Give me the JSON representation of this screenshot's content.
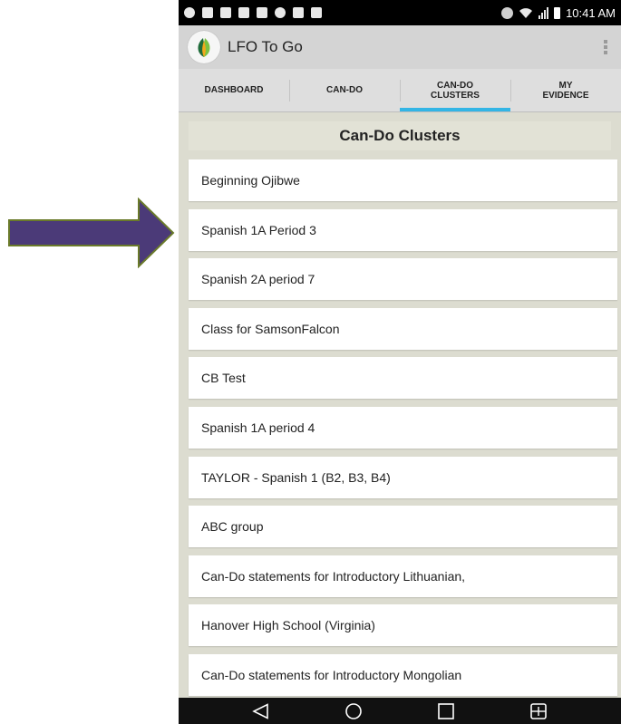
{
  "status_bar": {
    "time": "10:41 AM"
  },
  "action_bar": {
    "app_title": "LFO To Go",
    "app_icon": "leaf-logo-icon",
    "overflow_icon": "overflow-menu-icon"
  },
  "tabs": [
    {
      "label": "DASHBOARD",
      "selected": false
    },
    {
      "label": "CAN-DO",
      "selected": false
    },
    {
      "label": "CAN-DO\nCLUSTERS",
      "selected": true
    },
    {
      "label": "MY\nEVIDENCE",
      "selected": false
    }
  ],
  "content": {
    "section_title": "Can-Do Clusters",
    "clusters": [
      "Beginning Ojibwe",
      "Spanish 1A Period 3",
      "Spanish 2A period 7",
      "Class for SamsonFalcon",
      "CB Test",
      "Spanish 1A period 4",
      "TAYLOR - Spanish 1 (B2, B3, B4)",
      "ABC group",
      "Can-Do statements for Introductory Lithuanian,",
      "Hanover High School (Virginia)",
      "Can-Do statements for Introductory Mongolian"
    ]
  },
  "nav_bar": {
    "icons": [
      "back-icon",
      "home-icon",
      "recent-apps-icon",
      "multi-window-icon"
    ]
  },
  "colors": {
    "arrow_fill": "#4b3a78",
    "arrow_stroke": "#6a7a2a",
    "tab_indicator": "#33b5e5",
    "content_background": "#dcdcd0"
  }
}
